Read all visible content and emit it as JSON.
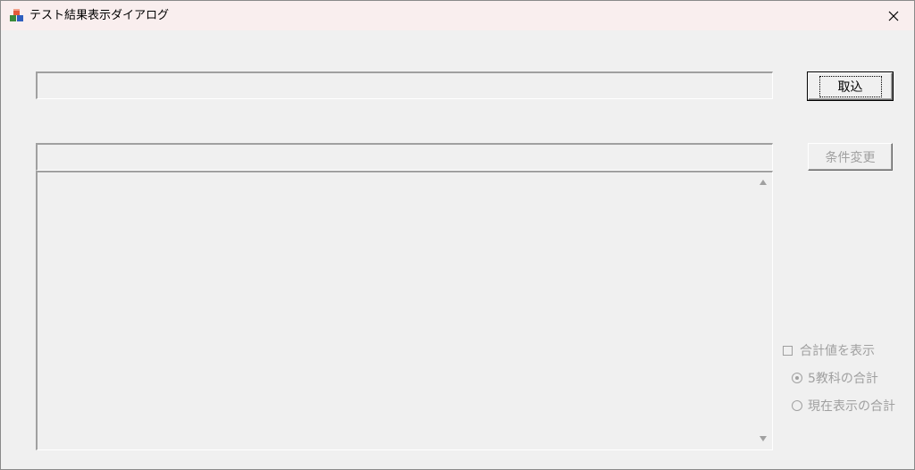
{
  "window": {
    "title": "テスト結果表示ダイアログ",
    "icon": "app-cubes-icon",
    "close_icon": "close-icon"
  },
  "buttons": {
    "import_label": "取込",
    "change_conditions_label": "条件変更"
  },
  "fields": {
    "path_value": "",
    "condition_value": ""
  },
  "options": {
    "show_total_label": "合計値を表示",
    "show_total_checked": false,
    "radio_five_subjects_label": "5教科の合計",
    "radio_five_subjects_selected": true,
    "radio_current_display_label": "現在表示の合計",
    "radio_current_display_selected": false
  },
  "colors": {
    "titlebar": "#f9eeee",
    "background": "#f0f0f0",
    "disabled_text": "#a0a0a0"
  }
}
